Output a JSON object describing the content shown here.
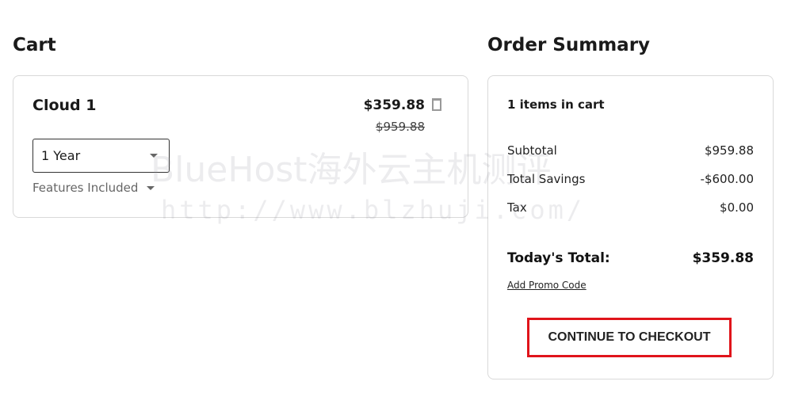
{
  "cart": {
    "title": "Cart",
    "item": {
      "name": "Cloud 1",
      "price": "$359.88",
      "original_price": "$959.88",
      "term": "1 Year",
      "features_label": "Features Included"
    }
  },
  "summary": {
    "title": "Order Summary",
    "items_count": "1 items in cart",
    "rows": [
      {
        "label": "Subtotal",
        "value": "$959.88"
      },
      {
        "label": "Total Savings",
        "value": "-$600.00"
      },
      {
        "label": "Tax",
        "value": "$0.00"
      }
    ],
    "total_label": "Today's Total:",
    "total_value": "$359.88",
    "promo_link": "Add Promo Code",
    "checkout_button": "CONTINUE TO CHECKOUT"
  },
  "watermark": {
    "line1": "BlueHost海外云主机测评",
    "line2": "http://www.blzhuji.com/"
  },
  "colors": {
    "highlight": "#e0141b"
  }
}
